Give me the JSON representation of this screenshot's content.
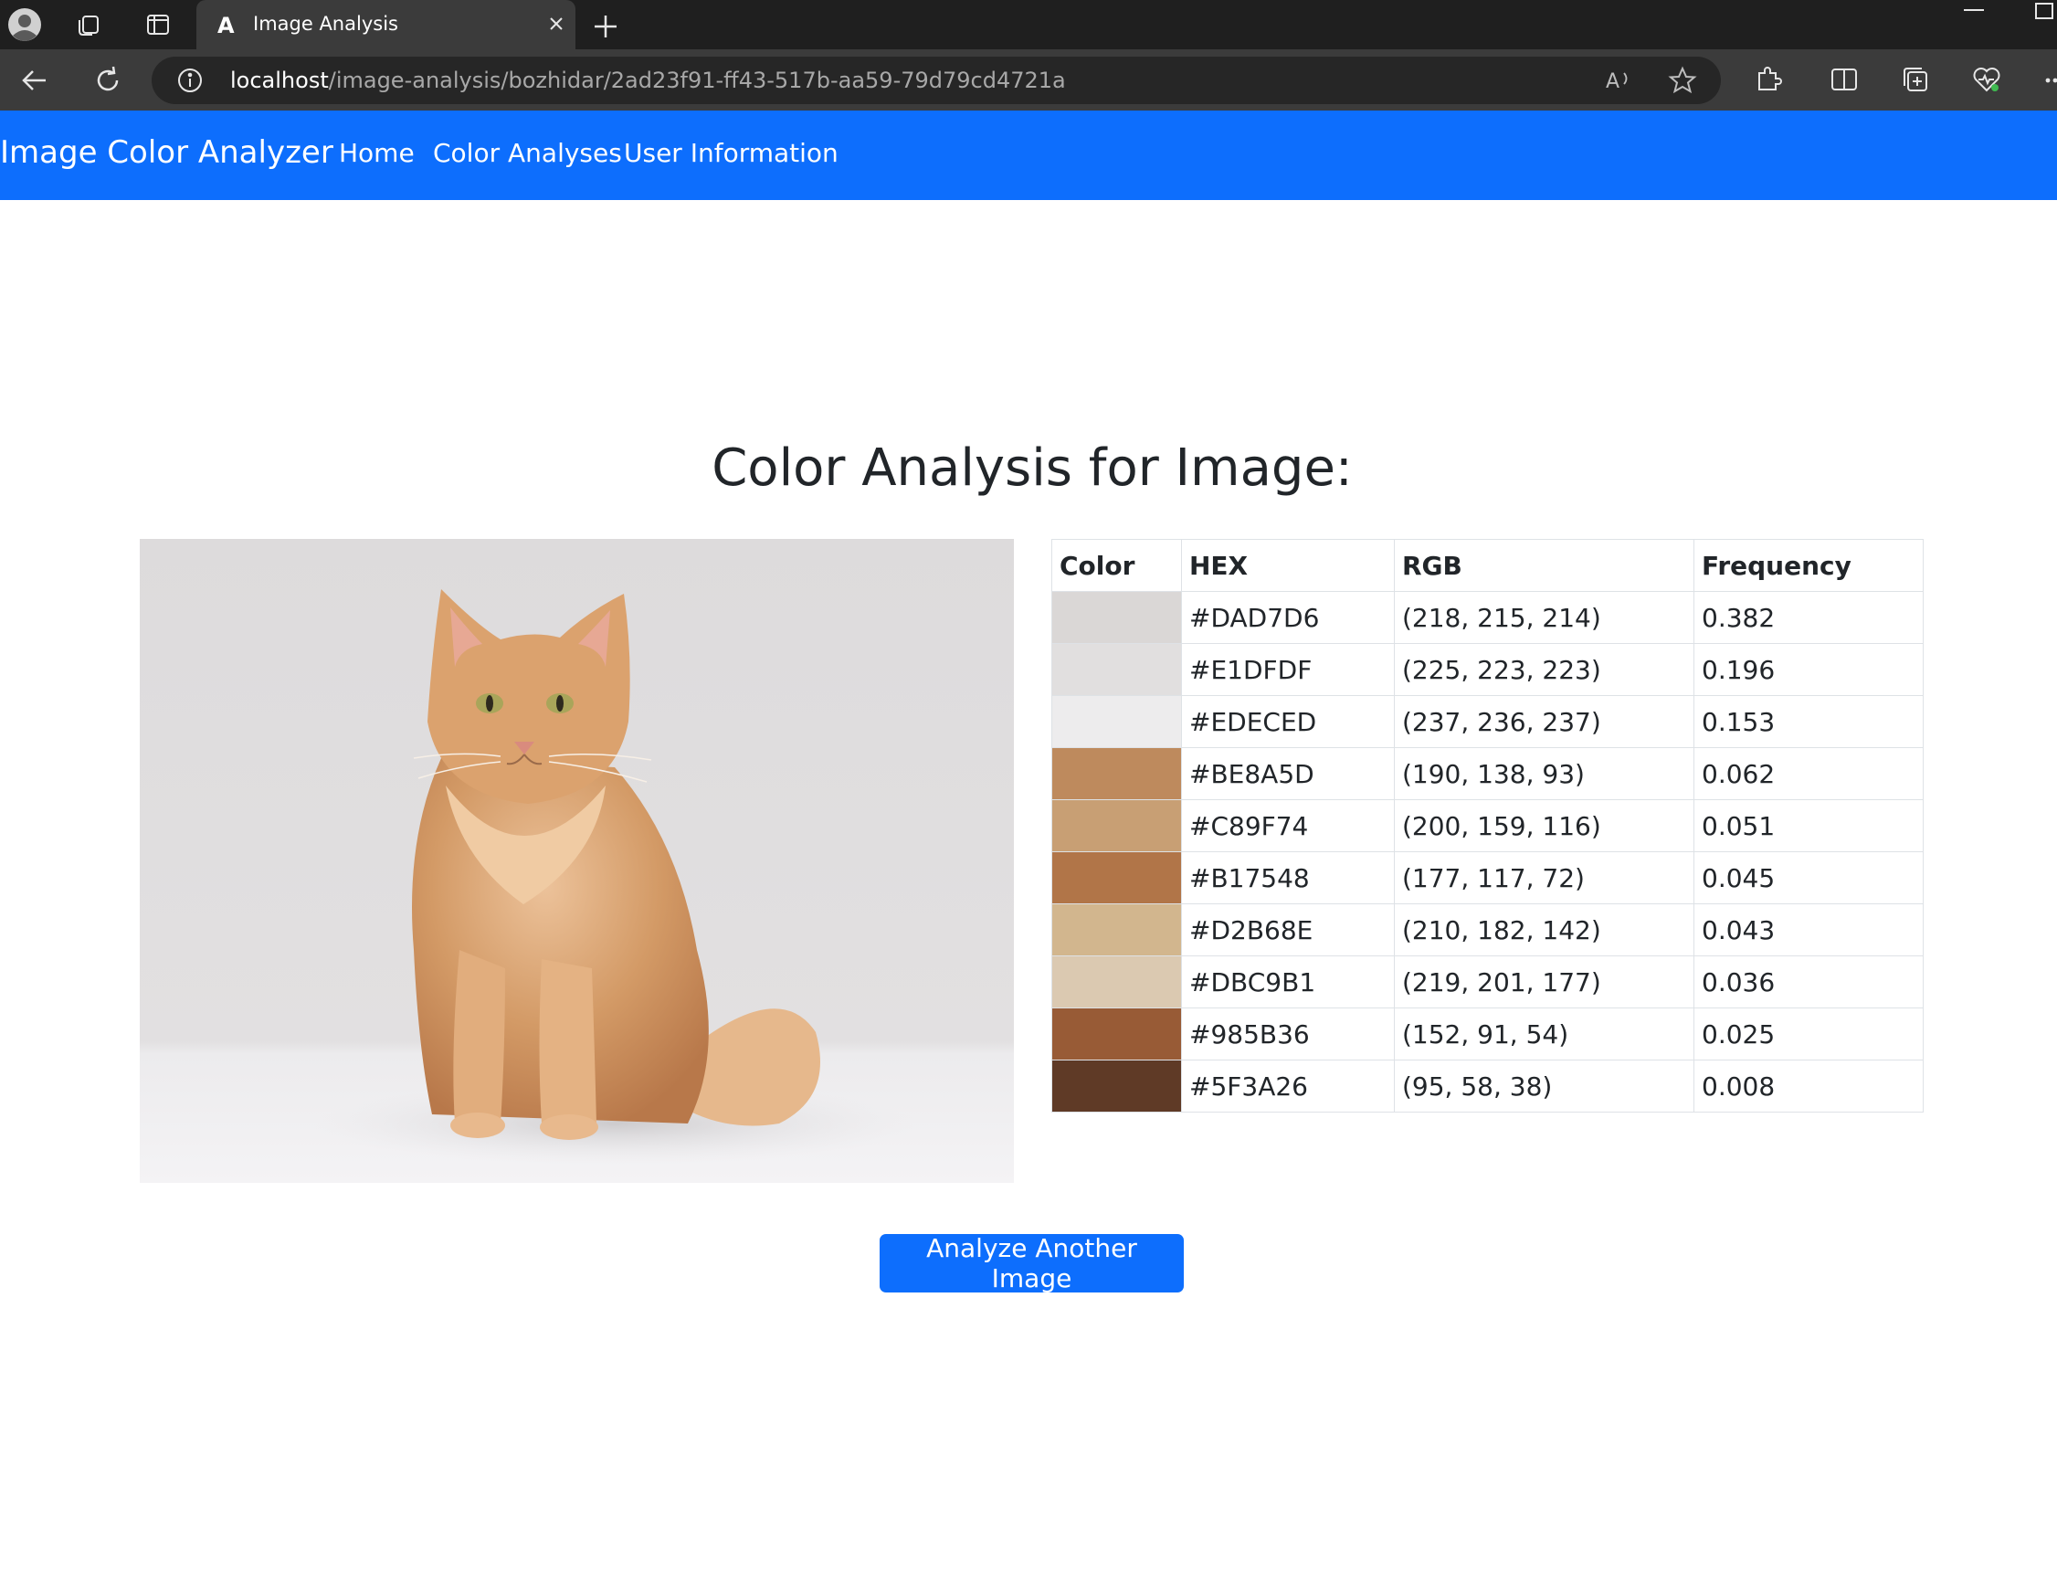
{
  "browser": {
    "tab_title": "Image Analysis",
    "url_host": "localhost",
    "url_path": "/image-analysis/bozhidar/2ad23f91-ff43-517b-aa59-79d79cd4721a"
  },
  "navbar": {
    "brand": "Image Color Analyzer",
    "links": [
      "Home",
      "Color Analyses",
      "User Information"
    ]
  },
  "main": {
    "title": "Color Analysis for Image:",
    "image_subject": "orange tabby cat sitting on white background",
    "button_label": "Analyze Another Image"
  },
  "table": {
    "headers": [
      "Color",
      "HEX",
      "RGB",
      "Frequency"
    ],
    "rows": [
      {
        "hex": "#DAD7D6",
        "rgb": "(218, 215, 214)",
        "frequency": "0.382"
      },
      {
        "hex": "#E1DFDF",
        "rgb": "(225, 223, 223)",
        "frequency": "0.196"
      },
      {
        "hex": "#EDECED",
        "rgb": "(237, 236, 237)",
        "frequency": "0.153"
      },
      {
        "hex": "#BE8A5D",
        "rgb": "(190, 138, 93)",
        "frequency": "0.062"
      },
      {
        "hex": "#C89F74",
        "rgb": "(200, 159, 116)",
        "frequency": "0.051"
      },
      {
        "hex": "#B17548",
        "rgb": "(177, 117, 72)",
        "frequency": "0.045"
      },
      {
        "hex": "#D2B68E",
        "rgb": "(210, 182, 142)",
        "frequency": "0.043"
      },
      {
        "hex": "#DBC9B1",
        "rgb": "(219, 201, 177)",
        "frequency": "0.036"
      },
      {
        "hex": "#985B36",
        "rgb": "(152, 91, 54)",
        "frequency": "0.025"
      },
      {
        "hex": "#5F3A26",
        "rgb": "(95, 58, 38)",
        "frequency": "0.008"
      }
    ]
  },
  "colors": {
    "navbar": "#0d6efd",
    "button": "#0d6efd",
    "chrome_dark": "#1f1f1f",
    "chrome_mid": "#3b3b3b"
  }
}
